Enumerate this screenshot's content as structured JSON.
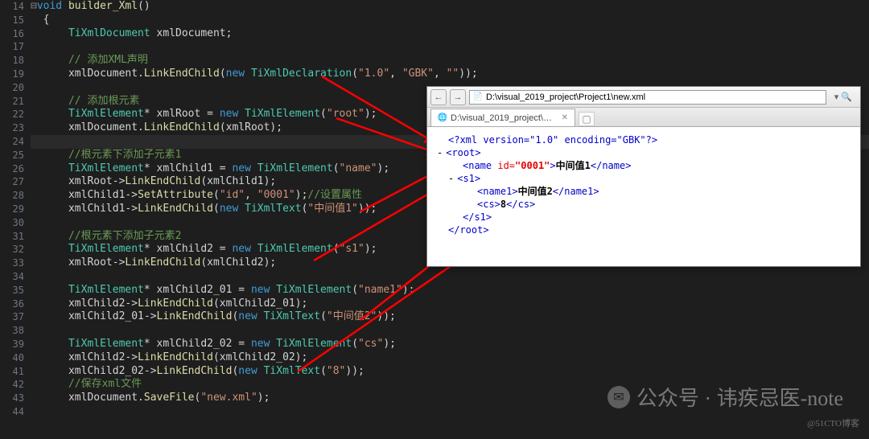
{
  "gutter_start": 14,
  "gutter_end": 44,
  "code_lines": {
    "l14": {
      "kw": "void",
      "fn": "builder_Xml",
      "rest": "()"
    },
    "l16": {
      "ty": "TiXmlDocument",
      "var": " xmlDocument;"
    },
    "l18": {
      "cmt": "// 添加XML声明"
    },
    "l19": {
      "a": "xmlDocument.",
      "fn": "LinkEndChild",
      "b": "(",
      "kw": "new",
      "ty": "TiXmlDeclaration",
      "c": "(",
      "s1": "\"1.0\"",
      "d": ", ",
      "s2": "\"GBK\"",
      "e": ", ",
      "s3": "\"\"",
      "f": "));"
    },
    "l21": {
      "cmt": "// 添加根元素"
    },
    "l22": {
      "ty": "TiXmlElement",
      "a": "* xmlRoot = ",
      "kw": "new",
      "ty2": "TiXmlElement",
      "b": "(",
      "s": "\"root\"",
      "c": ");"
    },
    "l23": {
      "a": "xmlDocument.",
      "fn": "LinkEndChild",
      "b": "(xmlRoot);"
    },
    "l25": {
      "cmt": "//根元素下添加子元素1"
    },
    "l26": {
      "ty": "TiXmlElement",
      "a": "* xmlChild1 = ",
      "kw": "new",
      "ty2": "TiXmlElement",
      "b": "(",
      "s": "\"name\"",
      "c": ");"
    },
    "l27": {
      "a": "xmlRoot->",
      "fn": "LinkEndChild",
      "b": "(xmlChild1);"
    },
    "l28": {
      "a": "xmlChild1->",
      "fn": "SetAttribute",
      "b": "(",
      "s1": "\"id\"",
      "c": ", ",
      "s2": "\"0001\"",
      "d": ");",
      "cmt": "//设置属性"
    },
    "l29": {
      "a": "xmlChild1->",
      "fn": "LinkEndChild",
      "b": "(",
      "kw": "new",
      "ty": "TiXmlText",
      "c": "(",
      "s": "\"中间值1\"",
      "d": "));"
    },
    "l31": {
      "cmt": "//根元素下添加子元素2"
    },
    "l32": {
      "ty": "TiXmlElement",
      "a": "* xmlChild2 = ",
      "kw": "new",
      "ty2": "TiXmlElement",
      "b": "(",
      "s": "\"s1\"",
      "c": ");"
    },
    "l33": {
      "a": "xmlRoot->",
      "fn": "LinkEndChild",
      "b": "(xmlChild2);"
    },
    "l35": {
      "ty": "TiXmlElement",
      "a": "* xmlChild2_01 = ",
      "kw": "new",
      "ty2": "TiXmlElement",
      "b": "(",
      "s": "\"name1\"",
      "c": ");"
    },
    "l36": {
      "a": "xmlChild2->",
      "fn": "LinkEndChild",
      "b": "(xmlChild2_01);"
    },
    "l37": {
      "a": "xmlChild2_01->",
      "fn": "LinkEndChild",
      "b": "(",
      "kw": "new",
      "ty": "TiXmlText",
      "c": "(",
      "s": "\"中间值2\"",
      "d": "));"
    },
    "l39": {
      "ty": "TiXmlElement",
      "a": "* xmlChild2_02 = ",
      "kw": "new",
      "ty2": "TiXmlElement",
      "b": "(",
      "s": "\"cs\"",
      "c": ");"
    },
    "l40": {
      "a": "xmlChild2->",
      "fn": "LinkEndChild",
      "b": "(xmlChild2_02);"
    },
    "l41": {
      "a": "xmlChild2_02->",
      "fn": "LinkEndChild",
      "b": "(",
      "kw": "new",
      "ty": "TiXmlText",
      "c": "(",
      "s": "\"8\"",
      "d": "));"
    },
    "l42": {
      "cmt": "//保存xml文件"
    },
    "l43": {
      "a": "xmlDocument.",
      "fn": "SaveFile",
      "b": "(",
      "s": "\"new.xml\"",
      "c": ");"
    }
  },
  "browser": {
    "address": "D:\\visual_2019_project\\Project1\\new.xml",
    "tab_label": "D:\\visual_2019_project\\Pr...",
    "xml": {
      "decl": "<?xml version=\"1.0\" encoding=\"GBK\"?>",
      "root_open": "<root>",
      "name_open": "<name ",
      "name_attr": "id=",
      "name_val": "\"0001\"",
      "name_close_open": ">",
      "name_txt": "中间值1",
      "name_close": "</name>",
      "s1_open": "<s1>",
      "name1_open": "<name1>",
      "name1_txt": "中间值2",
      "name1_close": "</name1>",
      "cs_open": "<cs>",
      "cs_txt": "8",
      "cs_close": "</cs>",
      "s1_close": "</s1>",
      "root_close": "</root>"
    }
  },
  "watermark": {
    "text": "公众号 · 讳疾忌医-note",
    "small": "@51CTO博客"
  }
}
